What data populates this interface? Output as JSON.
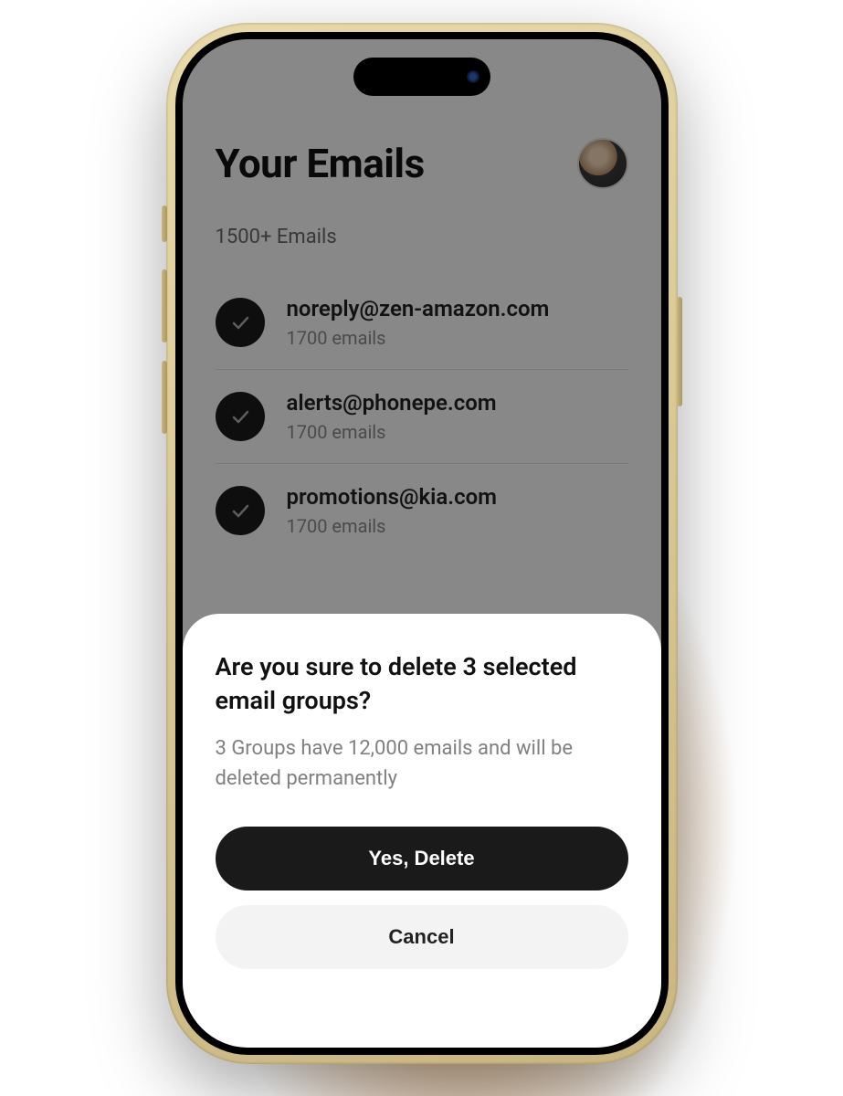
{
  "header": {
    "title": "Your Emails"
  },
  "subheader": {
    "text": "1500+ Emails"
  },
  "emails": [
    {
      "address": "noreply@zen-amazon.com",
      "count": "1700 emails"
    },
    {
      "address": "alerts@phonepe.com",
      "count": "1700 emails"
    },
    {
      "address": "promotions@kia.com",
      "count": "1700 emails"
    }
  ],
  "dialog": {
    "title": "Are you sure to delete 3 selected email groups?",
    "description": "3 Groups have 12,000 emails and will be deleted permanently",
    "confirm_label": "Yes, Delete",
    "cancel_label": "Cancel"
  }
}
